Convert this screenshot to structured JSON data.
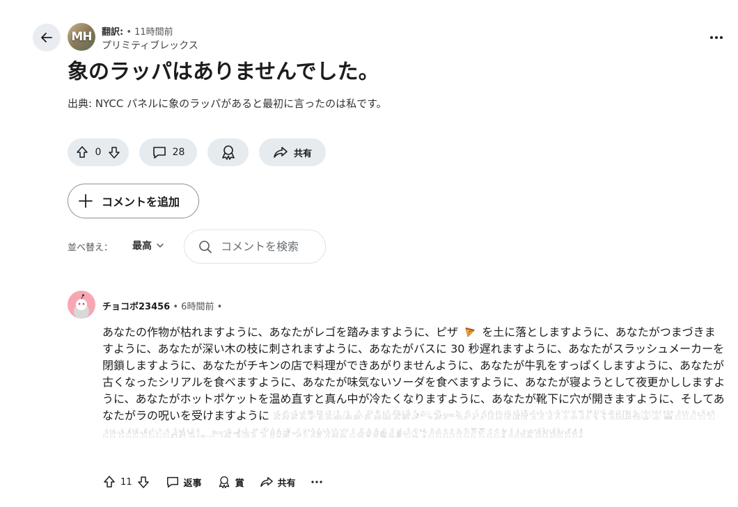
{
  "post": {
    "author": "翻訳:",
    "time": "• 11時間前",
    "community": "プリミティブレックス",
    "avatar_text": "MH",
    "title": "象のラッパはありませんでした。",
    "body": "出典: NYCC パネルに象のラッパがあると最初に言ったのは私です。",
    "votes": "0",
    "comments": "28",
    "share_label": "共有"
  },
  "actions": {
    "add_comment_label": "コメントを追加",
    "sort_label": "並べ替え：",
    "sort_value": "最高",
    "search_placeholder": "コメントを検索"
  },
  "comment": {
    "author": "チョコボ23456",
    "time": "• 6時間前 •",
    "text_a": "あなたの作物が枯れますように、あなたがレゴを踏みますように、ピザ",
    "text_b": "を土に落としますように、あなたがつまづきますように、あなたが深い木の枝に刺されますように、あなたがバスに 30 秒遅れますように、あなたがスラッシュメーカーを閉鎖しますように、あなたがチキンの店で料理ができあがりませんように、あなたが牛乳をすっぱくしますように、あなたが古くなったシリアルを食べますように、あなたが味気ないソーダを食べますように、あなたが寝ようとして夜更かししますように、あなたがホットポケットを温め直すと真ん中が冷たくなりますように、あなたが靴下に穴が開きますように、そしてあなたがラの呪いを受けますように",
    "tail": "𓀀𓀁𓀂𓀃𓀄𓀅𓀆𓀇𓀈𓀉𓀊𓀋𓀌𓀍𓀎𓀏𓀐𓀑𓀒𓀓𓀔𓀕𓀖𓀗𓀘𓀙𓀚𓀛𓀜𓀝𓀞𓀟𓀠𓀡𓀢𓀣𓀤𓀥𓀦𓀧𓀨𓀩𓀪𓀫𓀬𓀭𓀮𓀯𓀰𓀱𓀲𓀳𓀴𓀵𓀶𓀷𓀸𓀹𓀺𓀻𓀼𓀽𓀾𓀿𓁀𓁁𓁂𓁃𓁄𓁅𓁆𓁇𓁈𓁉𓁊𓁋𓁌𓁍𓁎𓁏𓁐𓁑𓁒𓁓𓁔𓁕𓁖𓁗𓁘𓁙𓁚𓁛𓁜𓁝𓁞𓁟𓁠𓁡𓁢𓁣𓁤𓁥𓁦𓁧𓁨𓁩𓁪𓁫𓁬𓁭𓁮𓁯",
    "votes": "11",
    "reply_label": "返事",
    "award_label": "賞",
    "share_label": "共有"
  },
  "icons": {
    "back": "arrow-left-icon",
    "more": "more-horizontal-icon",
    "upvote": "arrow-up-icon",
    "downvote": "arrow-down-icon",
    "comment": "speech-bubble-icon",
    "award": "award-icon",
    "share": "share-arrow-icon",
    "plus": "plus-icon",
    "chevron": "chevron-down-icon",
    "search": "search-icon",
    "pizza": "pizza-emoji-icon"
  }
}
